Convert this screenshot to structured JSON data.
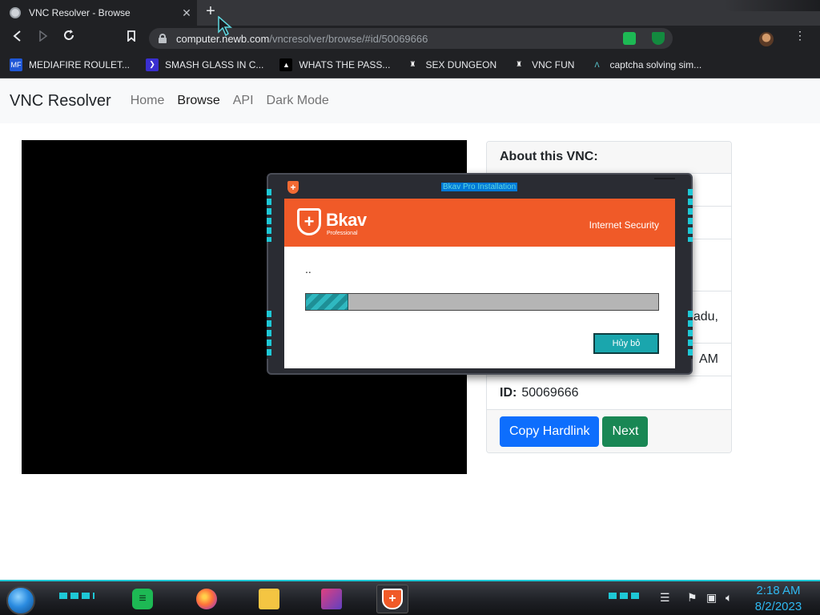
{
  "browser": {
    "tab": {
      "title": "VNC Resolver - Browse",
      "close": "✕"
    },
    "new_tab": "+",
    "url_host": "computer.newb.com",
    "url_path": "/vncresolver/browse/#id/50069666",
    "bookmarks": [
      {
        "label": "MEDIAFIRE ROULET...",
        "icon": "MF",
        "color": "#1f57d6"
      },
      {
        "label": "SMASH GLASS IN C...",
        "icon": "❯",
        "color": "#3a2fd0"
      },
      {
        "label": "WHATS THE PASS...",
        "icon": "▲",
        "color": "#111111"
      },
      {
        "label": "SEX DUNGEON",
        "icon": "♜",
        "color": "#202124"
      },
      {
        "label": "VNC FUN",
        "icon": "♜",
        "color": "#202124"
      },
      {
        "label": "captcha solving sim...",
        "icon": "Λ",
        "color": "#202124"
      }
    ]
  },
  "site": {
    "brand": "VNC Resolver",
    "nav": [
      "Home",
      "Browse",
      "API",
      "Dark Mode"
    ],
    "card": {
      "header": "About this VNC:",
      "partial_rows": [
        "adu,",
        "AM"
      ],
      "id_label": "ID:",
      "id_value": "50069666",
      "copy_button": "Copy Hardlink",
      "next_button": "Next"
    }
  },
  "dialog": {
    "title": "Bkav Pro Installation",
    "brand": "Bkav",
    "brand_sub": "Professional",
    "product": "Internet Security",
    "status": "..",
    "progress": 0.12,
    "cancel": "Hủy bỏ"
  },
  "taskbar": {
    "time": "2:18 AM",
    "date": "8/2/2023"
  },
  "colors": {
    "accent": "#1ec8d6",
    "bkav_orange": "#f05a28",
    "primary": "#0d6efd",
    "success": "#198754"
  }
}
